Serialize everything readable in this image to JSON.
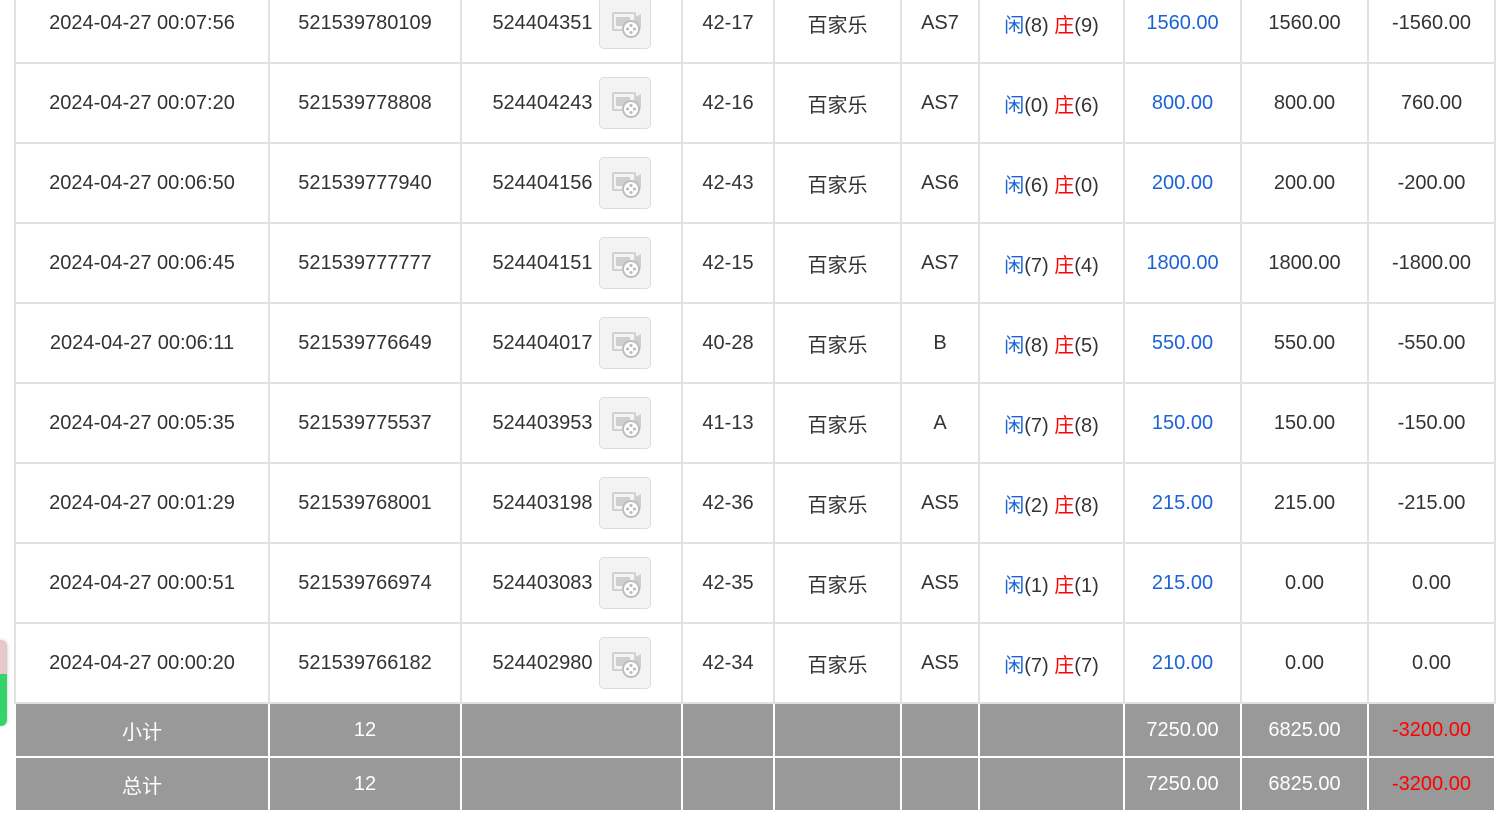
{
  "colors": {
    "player": "#1a62d8",
    "banker": "#ff0000",
    "negative": "#ff0000",
    "valid_bet": "#1a62d8",
    "summary_bg": "#999999"
  },
  "labels": {
    "player": "闲",
    "banker": "庄"
  },
  "rows": [
    {
      "time": "2024-04-27 00:07:56",
      "order_no": "521539780109",
      "round_no": "524404351",
      "table_no": "42-17",
      "game": "百家乐",
      "table": "AS7",
      "player_score": "(8)",
      "banker_score": "(9)",
      "bet": "1560.00",
      "valid_bet": "1560.00",
      "win_loss": "-1560.00",
      "win_loss_color": "red"
    },
    {
      "time": "2024-04-27 00:07:20",
      "order_no": "521539778808",
      "round_no": "524404243",
      "table_no": "42-16",
      "game": "百家乐",
      "table": "AS7",
      "player_score": "(0)",
      "banker_score": "(6)",
      "bet": "800.00",
      "valid_bet": "800.00",
      "win_loss": "760.00",
      "win_loss_color": "dark"
    },
    {
      "time": "2024-04-27 00:06:50",
      "order_no": "521539777940",
      "round_no": "524404156",
      "table_no": "42-43",
      "game": "百家乐",
      "table": "AS6",
      "player_score": "(6)",
      "banker_score": "(0)",
      "bet": "200.00",
      "valid_bet": "200.00",
      "win_loss": "-200.00",
      "win_loss_color": "red"
    },
    {
      "time": "2024-04-27 00:06:45",
      "order_no": "521539777777",
      "round_no": "524404151",
      "table_no": "42-15",
      "game": "百家乐",
      "table": "AS7",
      "player_score": "(7)",
      "banker_score": "(4)",
      "bet": "1800.00",
      "valid_bet": "1800.00",
      "win_loss": "-1800.00",
      "win_loss_color": "red"
    },
    {
      "time": "2024-04-27 00:06:11",
      "order_no": "521539776649",
      "round_no": "524404017",
      "table_no": "40-28",
      "game": "百家乐",
      "table": "B",
      "player_score": "(8)",
      "banker_score": "(5)",
      "bet": "550.00",
      "valid_bet": "550.00",
      "win_loss": "-550.00",
      "win_loss_color": "red"
    },
    {
      "time": "2024-04-27 00:05:35",
      "order_no": "521539775537",
      "round_no": "524403953",
      "table_no": "41-13",
      "game": "百家乐",
      "table": "A",
      "player_score": "(7)",
      "banker_score": "(8)",
      "bet": "150.00",
      "valid_bet": "150.00",
      "win_loss": "-150.00",
      "win_loss_color": "red"
    },
    {
      "time": "2024-04-27 00:01:29",
      "order_no": "521539768001",
      "round_no": "524403198",
      "table_no": "42-36",
      "game": "百家乐",
      "table": "AS5",
      "player_score": "(2)",
      "banker_score": "(8)",
      "bet": "215.00",
      "valid_bet": "215.00",
      "win_loss": "-215.00",
      "win_loss_color": "red"
    },
    {
      "time": "2024-04-27 00:00:51",
      "order_no": "521539766974",
      "round_no": "524403083",
      "table_no": "42-35",
      "game": "百家乐",
      "table": "AS5",
      "player_score": "(1)",
      "banker_score": "(1)",
      "bet": "215.00",
      "valid_bet": "0.00",
      "win_loss": "0.00",
      "win_loss_color": "dark"
    },
    {
      "time": "2024-04-27 00:00:20",
      "order_no": "521539766182",
      "round_no": "524402980",
      "table_no": "42-34",
      "game": "百家乐",
      "table": "AS5",
      "player_score": "(7)",
      "banker_score": "(7)",
      "bet": "210.00",
      "valid_bet": "0.00",
      "win_loss": "0.00",
      "win_loss_color": "dark"
    }
  ],
  "summary": [
    {
      "label": "小计",
      "count": "12",
      "bet": "7250.00",
      "valid_bet": "6825.00",
      "win_loss": "-3200.00"
    },
    {
      "label": "总计",
      "count": "12",
      "bet": "7250.00",
      "valid_bet": "6825.00",
      "win_loss": "-3200.00"
    }
  ],
  "icons": {
    "replay": "video-replay-icon"
  }
}
